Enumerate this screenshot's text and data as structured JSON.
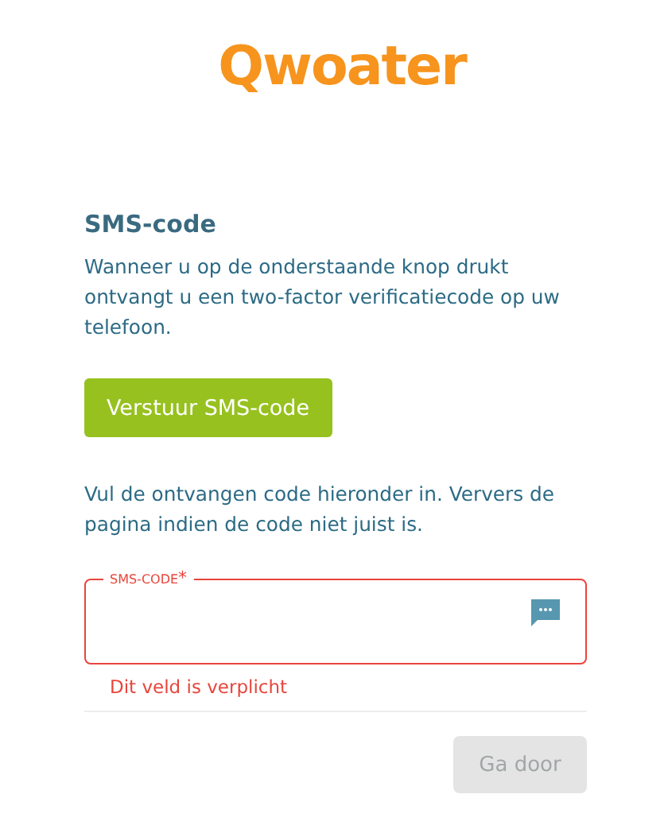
{
  "logo": "Qwoater",
  "heading": "SMS-code",
  "intro": "Wanneer u op de onderstaande knop drukt ontvangt u een two-factor verificatiecode op uw telefoon.",
  "send_button": "Verstuur SMS-code",
  "instructions": "Vul de ontvangen code hieronder in. Ververs de pagina indien de code niet juist is.",
  "field": {
    "label": "SMS-CODE",
    "required_mark": "*",
    "invalid": true,
    "error": "Dit veld is verplicht"
  },
  "continue_button": {
    "label": "Ga door",
    "disabled": true
  }
}
